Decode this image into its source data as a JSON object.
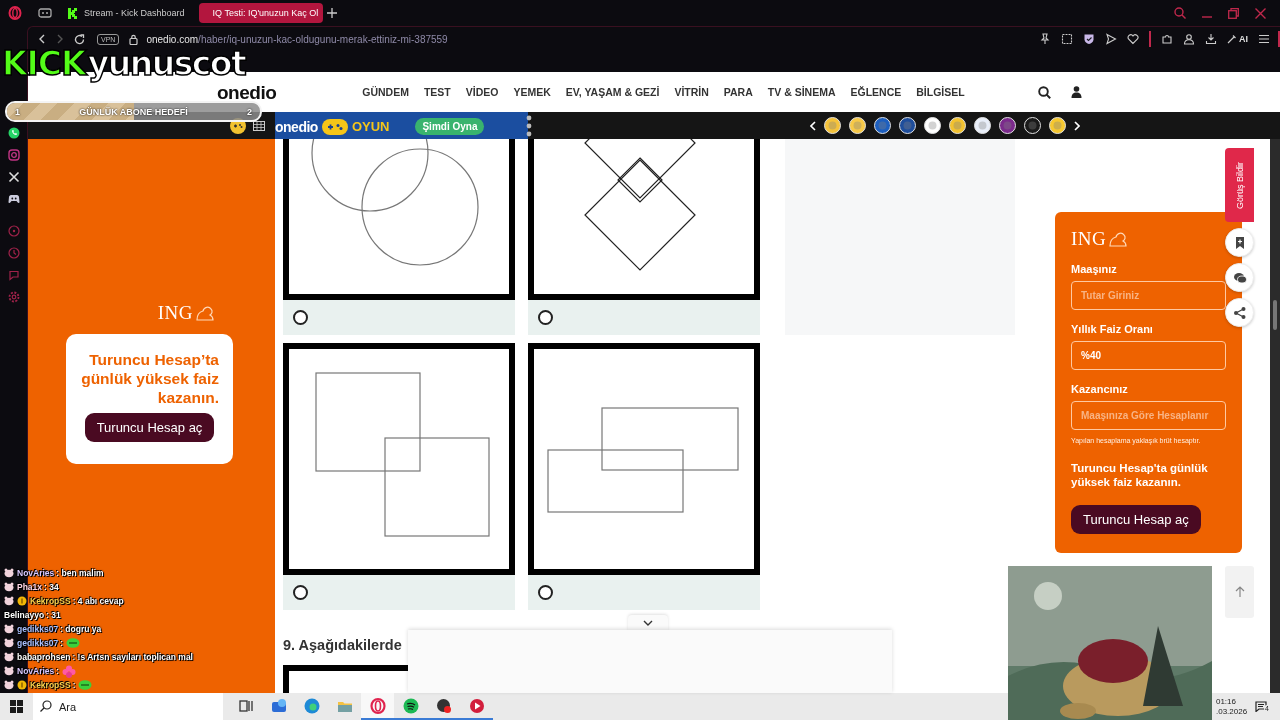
{
  "browser": {
    "tabs": [
      {
        "title": "Stream - Kick Dashboard",
        "selected": false
      },
      {
        "title": "IQ Testi: IQ'unuzun Kaç Ol",
        "selected": true
      }
    ],
    "address": {
      "vpn": "VPN",
      "host": "onedio.com",
      "path": "/haber/iq-unuzun-kac-oldugunu-merak-ettiniz-mi-387559"
    },
    "ai_label": "AI",
    "sidebar": [
      {
        "kind": "phone"
      },
      {
        "kind": "camera"
      },
      {
        "kind": "x"
      },
      {
        "kind": "gamepad"
      },
      {
        "kind": "player"
      },
      {
        "kind": "clock"
      },
      {
        "kind": "bubble"
      },
      {
        "kind": "gear"
      }
    ]
  },
  "site_nav": {
    "logo": "onedio",
    "items": [
      "GÜNDEM",
      "TEST",
      "VİDEO",
      "YEMEK",
      "EV, YAŞAM & GEZİ",
      "VİTRİN",
      "PARA",
      "TV & SİNEMA",
      "EĞLENCE",
      "BİLGİSEL"
    ]
  },
  "game_banner": {
    "brand": "onedio",
    "label": "OYUN",
    "button": "Şimdi Oyna"
  },
  "stickers": [
    {
      "color": "#f5c33b"
    },
    {
      "color": "#f7c948"
    },
    {
      "color": "#1d5fbf"
    },
    {
      "color": "#1f4e9c"
    },
    {
      "color": "#ffffff"
    },
    {
      "color": "#f2c230"
    },
    {
      "color": "#e8eef8"
    },
    {
      "color": "#7b2a8c"
    },
    {
      "color": "#1a1a1a"
    },
    {
      "color": "#f6c830"
    }
  ],
  "left_ad": {
    "brand": "ING",
    "headline": "Turuncu Hesap’ta günlük yüksek faiz kazanın.",
    "button": "Turuncu Hesap aç"
  },
  "quiz": {
    "options": [
      {
        "kind": "circles",
        "selected": false
      },
      {
        "kind": "diamonds",
        "selected": false
      },
      {
        "kind": "squares",
        "selected": false
      },
      {
        "kind": "rectangles",
        "selected": false
      }
    ],
    "next_question": "9. Aşağıdakilerde"
  },
  "calculator": {
    "brand": "ING",
    "fields": [
      {
        "label": "Maaşınız",
        "placeholder": "Tutar Giriniz"
      },
      {
        "label": "Yıllık Faiz Oranı",
        "value": "%40"
      },
      {
        "label": "Kazancınız",
        "placeholder": "Maaşınıza Göre Hesaplanır"
      }
    ],
    "note": "Yapılan hesaplama yaklaşık brüt hesaptır.",
    "headline": "Turuncu Hesap'ta günlük yüksek faiz kazanın.",
    "button": "Turuncu Hesap aç"
  },
  "feedback_tab": "Görüş Bildir",
  "float_buttons": [
    {
      "kind": "bookmark"
    },
    {
      "kind": "comments"
    },
    {
      "kind": "share"
    }
  ],
  "stream_overlay": {
    "brand": "KICK",
    "channel": "yunuscot",
    "goal": {
      "label": "GÜNLÜK ABONE HEDEFİ",
      "current": "1",
      "target": "2",
      "level": 0.5
    },
    "chat": [
      {
        "user": "NovAries",
        "color": "#d9c8ff",
        "pig_badge": true,
        "coin_badge": false,
        "text": ": ben malim"
      },
      {
        "user": "Pha1x",
        "color": "#ffd6e6",
        "pig_badge": true,
        "coin_badge": false,
        "text": ": 34"
      },
      {
        "user": "KekropSS",
        "color": "#ffd34d",
        "pig_badge": true,
        "coin_badge": true,
        "text": ": 4 abı cevap"
      },
      {
        "user": "Belinayyo",
        "color": "#ffffff",
        "pig_badge": false,
        "coin_badge": false,
        "text": ": 31"
      },
      {
        "user": "gedikks07",
        "color": "#a9c0ff",
        "pig_badge": true,
        "coin_badge": false,
        "text": ": dogru ya"
      },
      {
        "user": "gedikks07",
        "color": "#a9c0ff",
        "pig_badge": true,
        "coin_badge": false,
        "text": ":",
        "emote": {
          "kind": "green"
        }
      },
      {
        "user": "babaprohsen",
        "color": "#ffffff",
        "pig_badge": true,
        "coin_badge": false,
        "text": ": !s Artsn sayıları toplican mal"
      },
      {
        "user": "NovAries",
        "color": "#d9c8ff",
        "pig_badge": true,
        "coin_badge": false,
        "text": ":",
        "emote": {
          "kind": "flower"
        }
      },
      {
        "user": "KekropSS",
        "color": "#ffd34d",
        "pig_badge": true,
        "coin_badge": true,
        "text": ":",
        "emote": {
          "kind": "green"
        }
      }
    ]
  },
  "taskbar": {
    "search_placeholder": "Ara",
    "apps": [
      {
        "kind": "taskview",
        "running": false,
        "selected": false
      },
      {
        "kind": "widgets",
        "running": false,
        "selected": false
      },
      {
        "kind": "edge",
        "running": false,
        "selected": false
      },
      {
        "kind": "folder",
        "running": false,
        "selected": false
      },
      {
        "kind": "opera",
        "running": true,
        "selected": true
      },
      {
        "kind": "spotify",
        "running": true,
        "selected": false
      },
      {
        "kind": "obs",
        "running": true,
        "selected": false
      },
      {
        "kind": "recorder",
        "running": true,
        "selected": false
      }
    ],
    "time": "01:16",
    "date": ".03.2026",
    "notifications": "4"
  }
}
